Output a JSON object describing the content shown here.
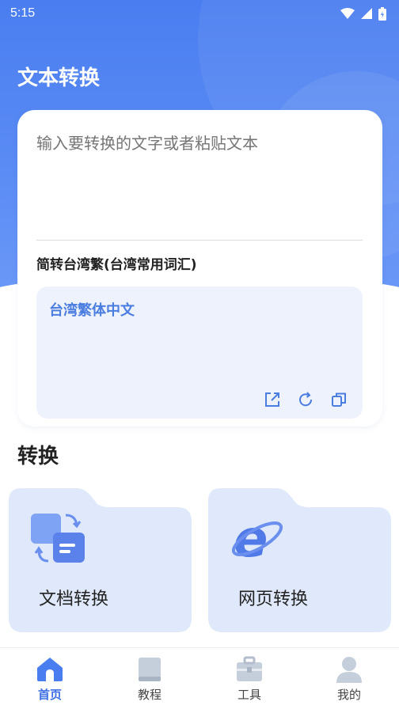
{
  "status_bar": {
    "time": "5:15"
  },
  "header": {
    "title": "文本转换"
  },
  "converter": {
    "input_placeholder": "输入要转换的文字或者粘贴文本",
    "mode_label": "简转台湾繁(台湾常用词汇)",
    "result_text": "台湾繁体中文"
  },
  "section": {
    "title": "转换"
  },
  "tiles": [
    {
      "label": "文档转换",
      "icon": "document-convert-icon"
    },
    {
      "label": "网页转换",
      "icon": "ie-browser-icon"
    }
  ],
  "bottom_nav": [
    {
      "label": "首页",
      "icon": "home-icon",
      "active": true
    },
    {
      "label": "教程",
      "icon": "book-icon",
      "active": false
    },
    {
      "label": "工具",
      "icon": "toolbox-icon",
      "active": false
    },
    {
      "label": "我的",
      "icon": "user-icon",
      "active": false
    }
  ],
  "colors": {
    "accent": "#4a7df0",
    "active_nav": "#3f6fe6",
    "tile_bg": "#dfe9fb"
  }
}
